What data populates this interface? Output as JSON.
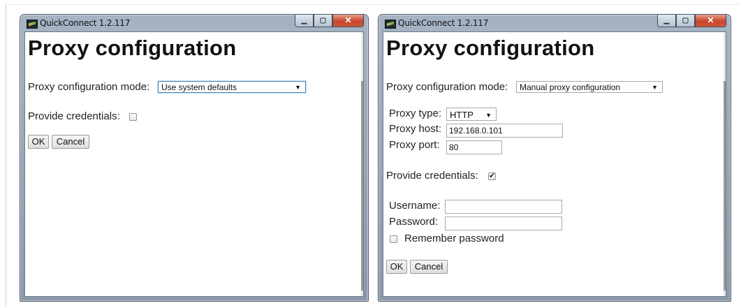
{
  "left_window": {
    "title": "QuickConnect 1.2.117",
    "heading": "Proxy configuration",
    "mode_label": "Proxy configuration mode:",
    "mode_value": "Use system defaults",
    "credentials_label": "Provide credentials:",
    "credentials_checked": false,
    "ok_label": "OK",
    "cancel_label": "Cancel"
  },
  "right_window": {
    "title": "QuickConnect 1.2.117",
    "heading": "Proxy configuration",
    "mode_label": "Proxy configuration mode:",
    "mode_value": "Manual proxy configuration",
    "proxy_type_label": "Proxy type:",
    "proxy_type_value": "HTTP",
    "proxy_host_label": "Proxy host:",
    "proxy_host_value": "192.168.0.101",
    "proxy_port_label": "Proxy port:",
    "proxy_port_value": "80",
    "credentials_label": "Provide credentials:",
    "credentials_checked": true,
    "username_label": "Username:",
    "username_value": "",
    "password_label": "Password:",
    "password_value": "",
    "remember_label": "Remember password",
    "remember_checked": false,
    "ok_label": "OK",
    "cancel_label": "Cancel"
  },
  "caption_buttons": {
    "minimize": "▁",
    "maximize": "▢",
    "close": "✕"
  }
}
